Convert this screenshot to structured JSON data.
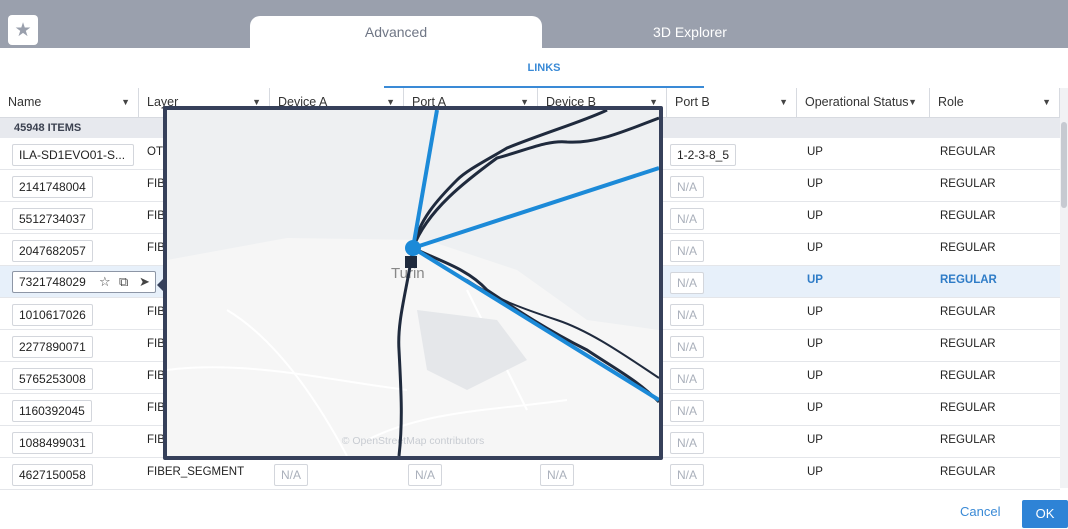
{
  "tabs": {
    "advanced": "Advanced",
    "explorer": "3D Explorer"
  },
  "subtab": {
    "links": "LINKS"
  },
  "columns": {
    "name": "Name",
    "layer": "Layer",
    "device_a": "Device A",
    "port_a": "Port A",
    "device_b": "Device B",
    "port_b": "Port B",
    "operational_status": "Operational Status",
    "role": "Role"
  },
  "item_count": "45948 ITEMS",
  "rows": [
    {
      "name": "ILA-SD1EVO01-S...",
      "layer": "OTS",
      "port_b": "1-2-3-8_5",
      "status": "UP",
      "role": "REGULAR"
    },
    {
      "name": "2141748004",
      "layer": "FIB",
      "port_b": "N/A",
      "status": "UP",
      "role": "REGULAR"
    },
    {
      "name": "5512734037",
      "layer": "FIB",
      "port_b": "N/A",
      "status": "UP",
      "role": "REGULAR"
    },
    {
      "name": "2047682057",
      "layer": "FIB",
      "port_b": "N/A",
      "status": "UP",
      "role": "REGULAR"
    },
    {
      "name": "7321748029",
      "layer": "",
      "port_b": "N/A",
      "status": "UP",
      "role": "REGULAR"
    },
    {
      "name": "1010617026",
      "layer": "FIB",
      "port_b": "N/A",
      "status": "UP",
      "role": "REGULAR"
    },
    {
      "name": "2277890071",
      "layer": "FIB",
      "port_b": "N/A",
      "status": "UP",
      "role": "REGULAR"
    },
    {
      "name": "5765253008",
      "layer": "FIB",
      "port_b": "N/A",
      "status": "UP",
      "role": "REGULAR"
    },
    {
      "name": "1160392045",
      "layer": "FIB",
      "port_b": "N/A",
      "status": "UP",
      "role": "REGULAR"
    },
    {
      "name": "1088499031",
      "layer": "FIB",
      "port_b": "N/A",
      "status": "UP",
      "role": "REGULAR"
    },
    {
      "name": "4627150058",
      "layer": "FIBER_SEGMENT",
      "device_a": "N/A",
      "port_a": "N/A",
      "device_b": "N/A",
      "port_b": "N/A",
      "status": "UP",
      "role": "REGULAR"
    }
  ],
  "map": {
    "city_label": "Turin",
    "attribution": "© OpenStreetMap contributors"
  },
  "footer": {
    "cancel": "Cancel",
    "ok": "OK"
  },
  "icons": {
    "favorite": "star-icon",
    "open": "open-external-icon",
    "locate": "navigate-arrow-icon",
    "sort": "caret-down-icon"
  },
  "colors": {
    "accent": "#2e83d6",
    "topbar": "#9aa0ad",
    "link_line": "#1c8ad8",
    "fiber_line": "#1f2a3d"
  }
}
